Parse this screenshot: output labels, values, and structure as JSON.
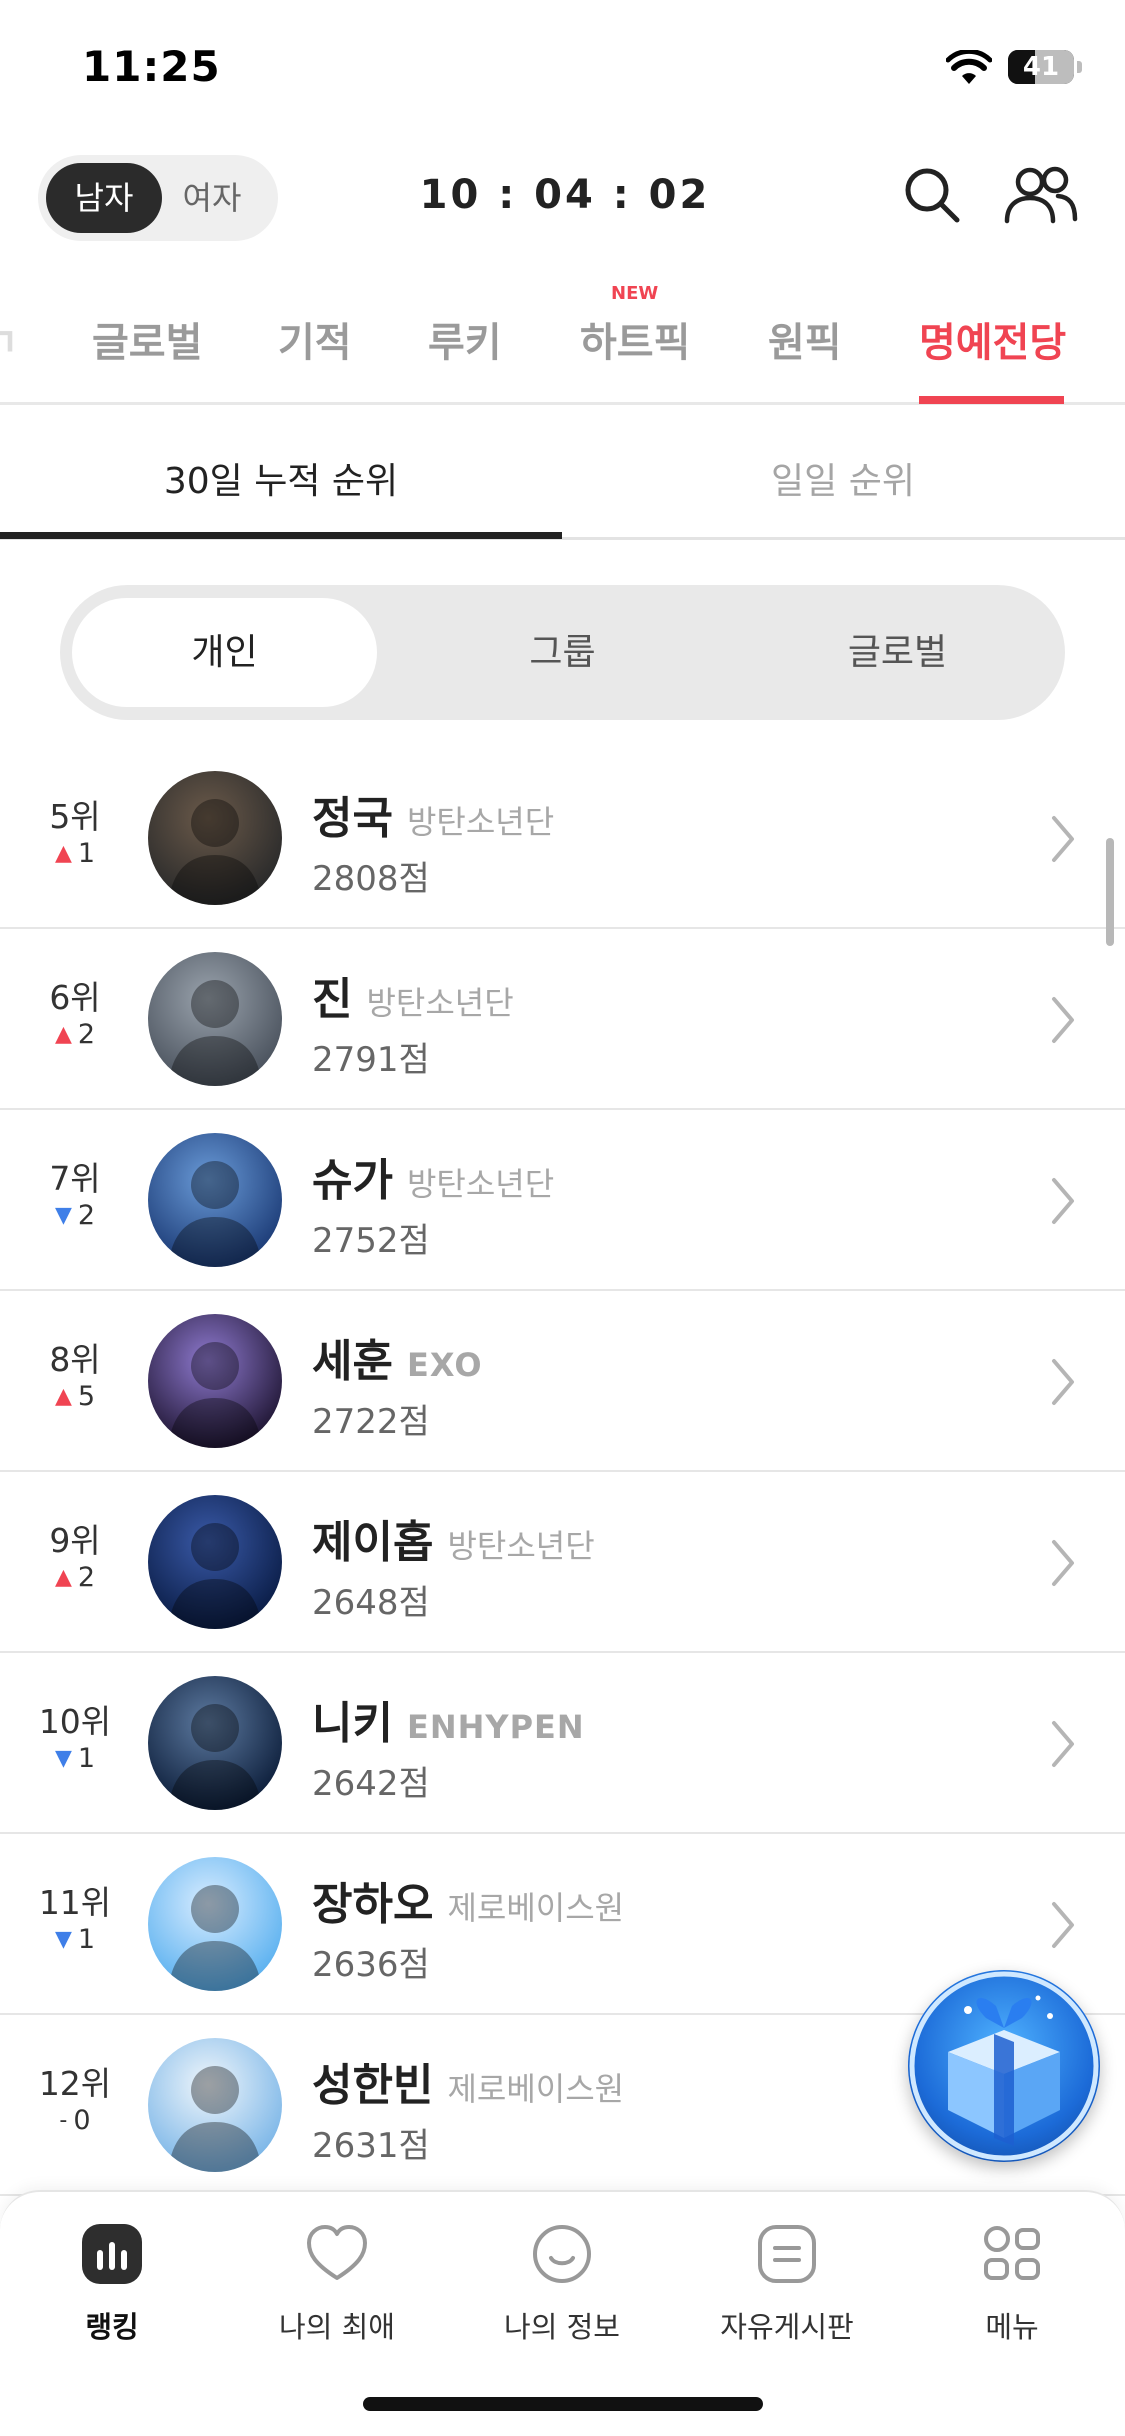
{
  "status_bar": {
    "time": "11:25",
    "battery": "41"
  },
  "header": {
    "gender_toggle": [
      {
        "label": "남자",
        "selected": true
      },
      {
        "label": "여자",
        "selected": false
      }
    ],
    "countdown": "10 : 04 : 02",
    "icons": [
      "search-icon",
      "people-icon"
    ]
  },
  "category_tabs": [
    {
      "label": "글로벌"
    },
    {
      "label": "기적"
    },
    {
      "label": "루키"
    },
    {
      "label": "하트픽",
      "badge": "NEW"
    },
    {
      "label": "원픽"
    },
    {
      "label": "명예전당",
      "selected": true
    }
  ],
  "sub_tabs": [
    {
      "label": "30일 누적 순위",
      "selected": true
    },
    {
      "label": "일일 순위"
    }
  ],
  "segment": [
    {
      "label": "개인",
      "selected": true
    },
    {
      "label": "그룹"
    },
    {
      "label": "글로벌"
    }
  ],
  "ranking": [
    {
      "rank": "5위",
      "trend": "up",
      "change": "1",
      "name": "정국",
      "group": "방탄소년단",
      "score": "2808점"
    },
    {
      "rank": "6위",
      "trend": "up",
      "change": "2",
      "name": "진",
      "group": "방탄소년단",
      "score": "2791점"
    },
    {
      "rank": "7위",
      "trend": "down",
      "change": "2",
      "name": "슈가",
      "group": "방탄소년단",
      "score": "2752점"
    },
    {
      "rank": "8위",
      "trend": "up",
      "change": "5",
      "name": "세훈",
      "group": "EXO",
      "score": "2722점"
    },
    {
      "rank": "9위",
      "trend": "up",
      "change": "2",
      "name": "제이홉",
      "group": "방탄소년단",
      "score": "2648점"
    },
    {
      "rank": "10위",
      "trend": "down",
      "change": "1",
      "name": "니키",
      "group": "ENHYPEN",
      "score": "2642점"
    },
    {
      "rank": "11위",
      "trend": "down",
      "change": "1",
      "name": "장하오",
      "group": "제로베이스원",
      "score": "2636점"
    },
    {
      "rank": "12위",
      "trend": "same",
      "change": "0",
      "name": "성한빈",
      "group": "제로베이스원",
      "score": "2631점"
    }
  ],
  "bottom_nav": [
    {
      "label": "랭킹",
      "icon": "ranking-chart-icon",
      "selected": true
    },
    {
      "label": "나의 최애",
      "icon": "heart-icon"
    },
    {
      "label": "나의 정보",
      "icon": "smile-icon"
    },
    {
      "label": "자유게시판",
      "icon": "board-icon"
    },
    {
      "label": "메뉴",
      "icon": "menu-grid-icon"
    }
  ],
  "colors": {
    "accent": "#f04452",
    "trend_up": "#f04452",
    "trend_down": "#3f7fe8"
  }
}
